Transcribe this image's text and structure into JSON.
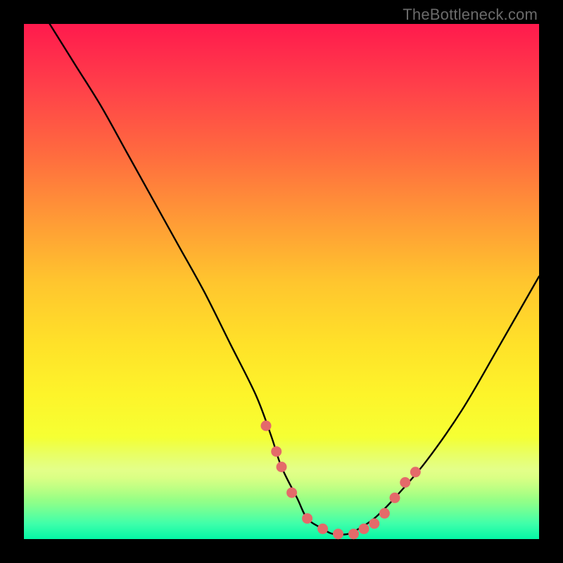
{
  "watermark": "TheBottleneck.com",
  "colors": {
    "dot": "#e46a6a",
    "curve": "#000000",
    "background_frame": "#000000"
  },
  "chart_data": {
    "type": "line",
    "title": "",
    "xlabel": "",
    "ylabel": "",
    "xlim": [
      0,
      100
    ],
    "ylim": [
      0,
      100
    ],
    "grid": false,
    "legend": false,
    "series": [
      {
        "name": "bottleneck-curve",
        "x": [
          5,
          10,
          15,
          20,
          25,
          30,
          35,
          40,
          45,
          48,
          50,
          53,
          55,
          58,
          60,
          63,
          65,
          68,
          72,
          78,
          85,
          92,
          100
        ],
        "y": [
          100,
          92,
          84,
          75,
          66,
          57,
          48,
          38,
          28,
          20,
          14,
          8,
          4,
          2,
          1,
          1,
          2,
          4,
          8,
          15,
          25,
          37,
          51
        ]
      }
    ],
    "highlight_points": {
      "name": "highlight-dots",
      "x": [
        47,
        49,
        50,
        52,
        55,
        58,
        61,
        64,
        66,
        68,
        70,
        72,
        74,
        76
      ],
      "y": [
        22,
        17,
        14,
        9,
        4,
        2,
        1,
        1,
        2,
        3,
        5,
        8,
        11,
        13
      ]
    }
  }
}
